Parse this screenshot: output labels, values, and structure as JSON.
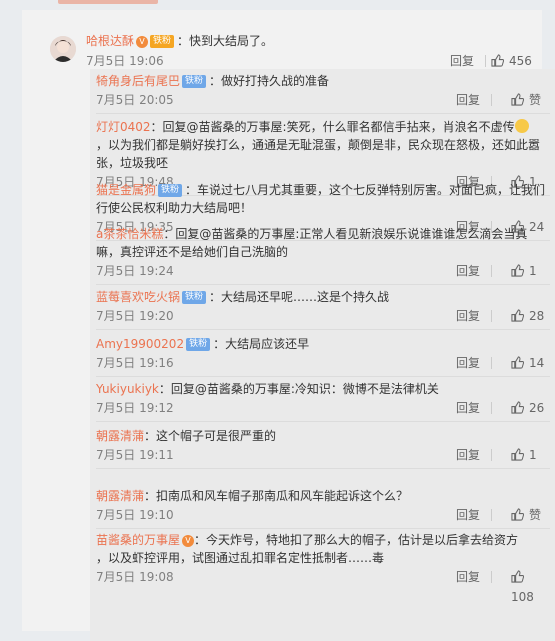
{
  "main": {
    "user": "哈根达酥",
    "text": "：快到大结局了。",
    "date": "7月5日 19:06",
    "reply_label": "回复",
    "likes": "456"
  },
  "badges": {
    "fan": "铁粉"
  },
  "replies": [
    {
      "user": "犄角身后有尾巴",
      "badge": "fan",
      "text": "：做好打持久战的准备",
      "date": "7月5日 20:05",
      "likes": "赞"
    },
    {
      "user": "灯灯0402",
      "text_lines": [
        "：回复@苗酱桑的万事屋:笑死，什么罪名都信手拈来，肖浪名不虚传",
        "，以为我们都是躺好挨打么，通通是无耻混蛋，颠倒是非，民众现在怒极，还如此嚣",
        "张，垃圾我呸"
      ],
      "date": "7月5日 19:48",
      "likes": "1"
    },
    {
      "user": "猫是金属狗",
      "badge": "fan",
      "text_lines": [
        "：车说过七八月尤其重要，这个七反弹特别厉害。对面已疯，让我们",
        "行使公民权利助力大结局吧！"
      ],
      "date": "7月5日 19:35",
      "likes": "24"
    },
    {
      "user": "a茶茶恰米糕",
      "text_lines": [
        "：回复@苗酱桑的万事屋:正常人看见新浪娱乐说谁谁谁怎么滴会当真",
        "嘛，真控评还不是给她们自己洗脑的"
      ],
      "date": "7月5日 19:24",
      "likes": "1"
    },
    {
      "user": "蓝莓喜欢吃火锅",
      "badge": "fan",
      "text": "：大结局还早呢……这是个持久战",
      "date": "7月5日 19:20",
      "likes": "28"
    },
    {
      "user": "Amy19900202",
      "badge": "fan",
      "text": "：大结局应该还早",
      "date": "7月5日 19:16",
      "likes": "14"
    },
    {
      "user": "Yukiyukiyk",
      "text": "：回复@苗酱桑的万事屋:冷知识：微博不是法律机关",
      "date": "7月5日 19:12",
      "likes": "26"
    },
    {
      "user": "朝露清蒲",
      "text": "：这个帽子可是很严重的",
      "date": "7月5日 19:11",
      "likes": "1"
    },
    {
      "user": "朝露清蒲",
      "text": "：扣南瓜和风车帽子那南瓜和风车能起诉这个么？",
      "date": "7月5日 19:10",
      "likes": "赞"
    },
    {
      "user": "苗酱桑的万事屋",
      "vip": true,
      "text_lines": [
        "：今天炸号，特地扣了那么大的帽子，估计是以后拿去给资方",
        "，以及虾控评用，试图通过乱扣罪名定性抵制者……毒"
      ],
      "date": "7月5日 19:08",
      "likes": "108"
    }
  ],
  "reply_label": "回复",
  "colors": {
    "accent": "#eb7350",
    "badge_blue": "#6fa7e8"
  }
}
